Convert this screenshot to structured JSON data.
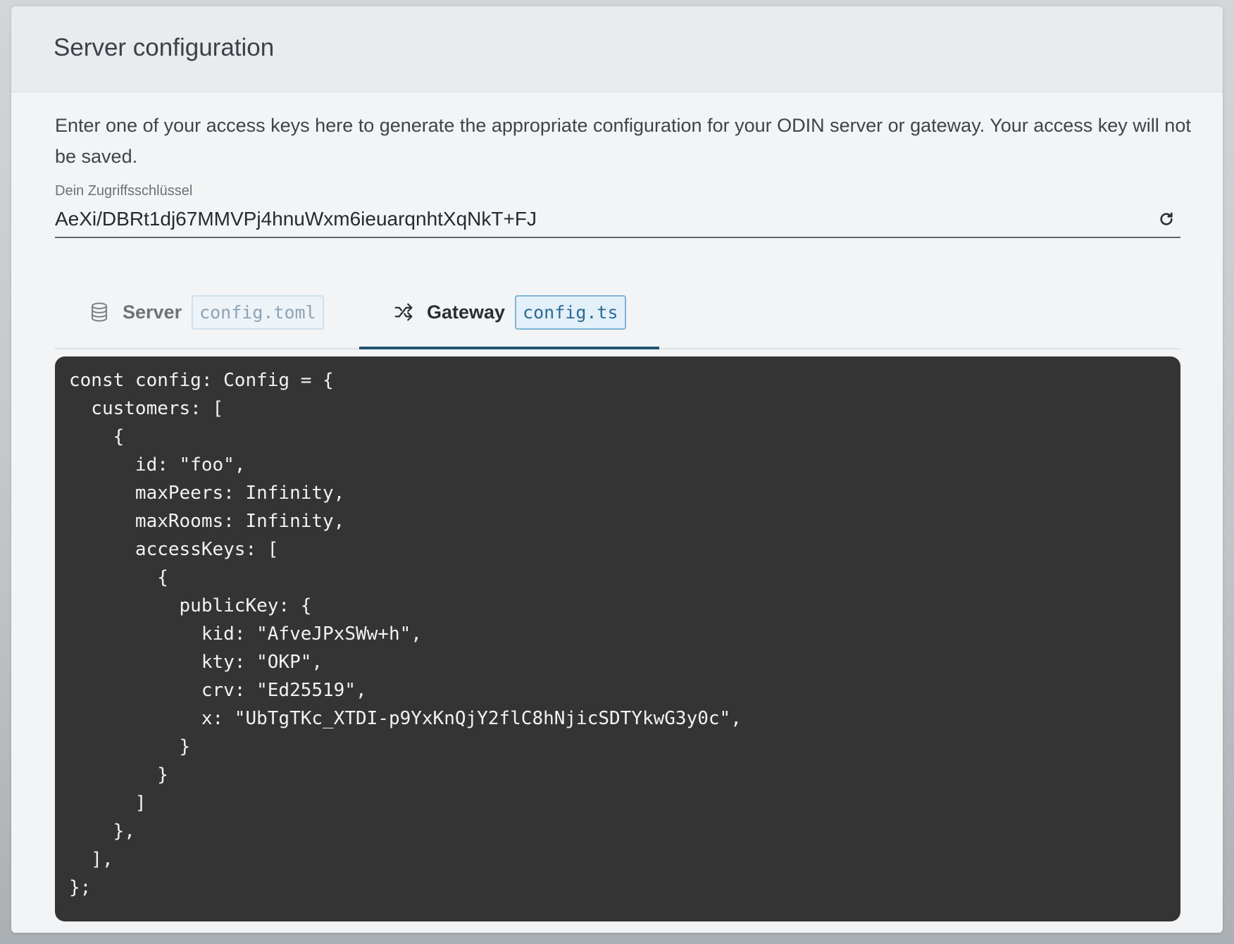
{
  "card": {
    "title": "Server configuration",
    "description": "Enter one of your access keys here to generate the appropriate configuration for your ODIN server or gateway. Your access key will not be saved."
  },
  "access_key_field": {
    "label": "Dein Zugriffsschlüssel",
    "value": "AeXi/DBRt1dj67MMVPj4hnuWxm6ieuarqnhtXqNkT+FJ",
    "refresh_icon": "refresh-icon"
  },
  "tabs": [
    {
      "label": "Server",
      "badge": "config.toml",
      "icon": "database-icon",
      "active": false
    },
    {
      "label": "Gateway",
      "badge": "config.ts",
      "icon": "shuffle-icon",
      "active": true
    }
  ],
  "code": {
    "lines": [
      "const config: Config = {",
      "  customers: [",
      "    {",
      "      id: \"foo\",",
      "      maxPeers: Infinity,",
      "      maxRooms: Infinity,",
      "      accessKeys: [",
      "        {",
      "          publicKey: {",
      "            kid: \"AfveJPxSWw+h\",",
      "            kty: \"OKP\",",
      "            crv: \"Ed25519\",",
      "            x: \"UbTgTKc_XTDI-p9YxKnQjY2flC8hNjicSDTYkwG3y0c\",",
      "          }",
      "        }",
      "      ]",
      "    },",
      "  ],",
      "};"
    ]
  },
  "colors": {
    "active_tab_underline": "#1f5571",
    "code_background": "#343434",
    "active_badge_text": "#2a6b93"
  }
}
